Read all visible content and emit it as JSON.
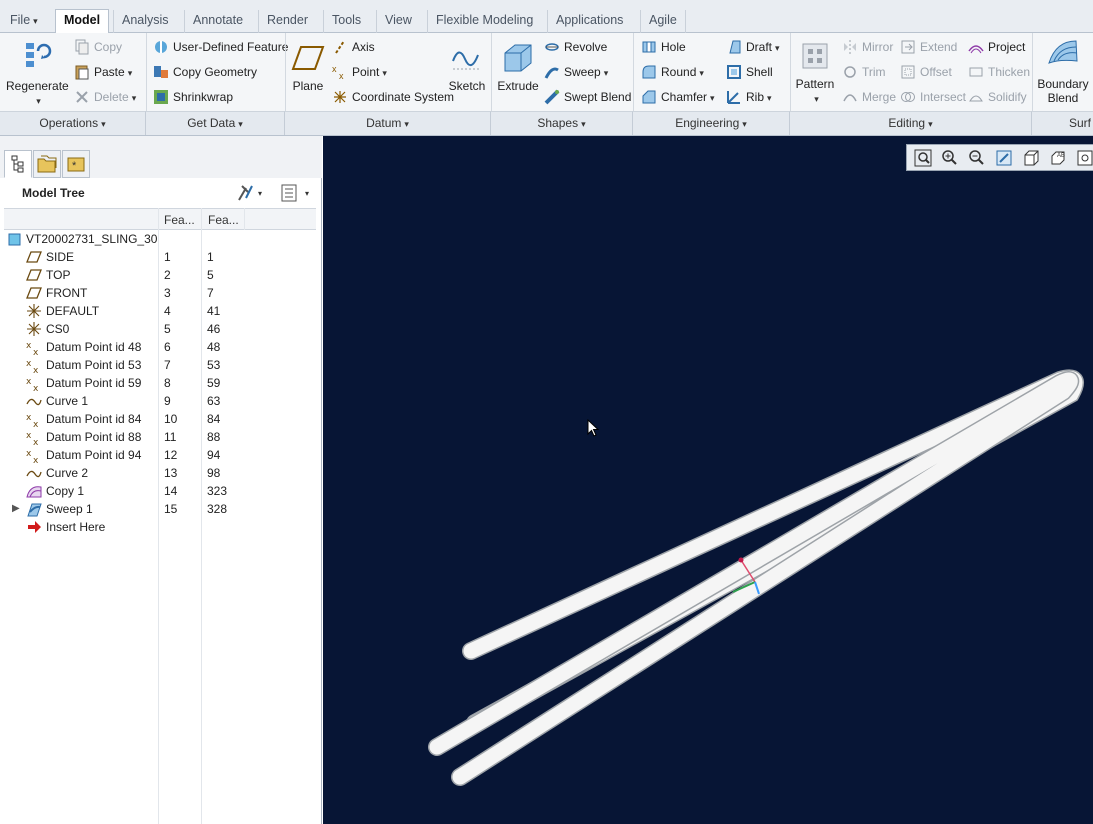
{
  "tabs": [
    "File",
    "Model",
    "Analysis",
    "Annotate",
    "Render",
    "Tools",
    "View",
    "Flexible Modeling",
    "Applications",
    "Agile"
  ],
  "ribbon": {
    "operations": {
      "regenerate": "Regenerate",
      "copy": "Copy",
      "paste": "Paste",
      "delete": "Delete",
      "footer": "Operations"
    },
    "get_data": {
      "udf": "User-Defined Feature",
      "copy_geometry": "Copy Geometry",
      "shrinkwrap": "Shrinkwrap",
      "footer": "Get Data"
    },
    "datum": {
      "plane": "Plane",
      "axis": "Axis",
      "point": "Point",
      "csys": "Coordinate System",
      "sketch": "Sketch",
      "footer": "Datum"
    },
    "shapes": {
      "extrude": "Extrude",
      "revolve": "Revolve",
      "sweep": "Sweep",
      "swept_blend": "Swept Blend",
      "footer": "Shapes"
    },
    "engineering": {
      "hole": "Hole",
      "round": "Round",
      "chamfer": "Chamfer",
      "draft": "Draft",
      "shell": "Shell",
      "rib": "Rib",
      "footer": "Engineering"
    },
    "editing": {
      "pattern": "Pattern",
      "mirror": "Mirror",
      "trim": "Trim",
      "merge": "Merge",
      "extend": "Extend",
      "offset": "Offset",
      "intersect": "Intersect",
      "project": "Project",
      "thicken": "Thicken",
      "solidify": "Solidify",
      "footer": "Editing"
    },
    "surfaces": {
      "boundary_blend_1": "Boundary",
      "boundary_blend_2": "Blend",
      "footer": "Surf"
    }
  },
  "model_tree": {
    "title": "Model Tree",
    "col1": "Fea...",
    "col2": "Fea...",
    "root": "VT20002731_SLING_30",
    "items": [
      {
        "name": "SIDE",
        "n": "1",
        "id": "1",
        "icon": "datum-plane"
      },
      {
        "name": "TOP",
        "n": "2",
        "id": "5",
        "icon": "datum-plane"
      },
      {
        "name": "FRONT",
        "n": "3",
        "id": "7",
        "icon": "datum-plane"
      },
      {
        "name": "DEFAULT",
        "n": "4",
        "id": "41",
        "icon": "csys"
      },
      {
        "name": "CS0",
        "n": "5",
        "id": "46",
        "icon": "csys"
      },
      {
        "name": "Datum Point id 48",
        "n": "6",
        "id": "48",
        "icon": "datum-point"
      },
      {
        "name": "Datum Point id 53",
        "n": "7",
        "id": "53",
        "icon": "datum-point"
      },
      {
        "name": "Datum Point id 59",
        "n": "8",
        "id": "59",
        "icon": "datum-point"
      },
      {
        "name": "Curve 1",
        "n": "9",
        "id": "63",
        "icon": "curve"
      },
      {
        "name": "Datum Point id 84",
        "n": "10",
        "id": "84",
        "icon": "datum-point"
      },
      {
        "name": "Datum Point id 88",
        "n": "11",
        "id": "88",
        "icon": "datum-point"
      },
      {
        "name": "Datum Point id 94",
        "n": "12",
        "id": "94",
        "icon": "datum-point"
      },
      {
        "name": "Curve 2",
        "n": "13",
        "id": "98",
        "icon": "curve"
      },
      {
        "name": "Copy 1",
        "n": "14",
        "id": "323",
        "icon": "copy-surface"
      },
      {
        "name": "Sweep 1",
        "n": "15",
        "id": "328",
        "icon": "sweep"
      }
    ],
    "insert_here": "Insert Here"
  },
  "colors": {
    "viewport_bg": "#071535",
    "accent": "#3c78b4"
  }
}
